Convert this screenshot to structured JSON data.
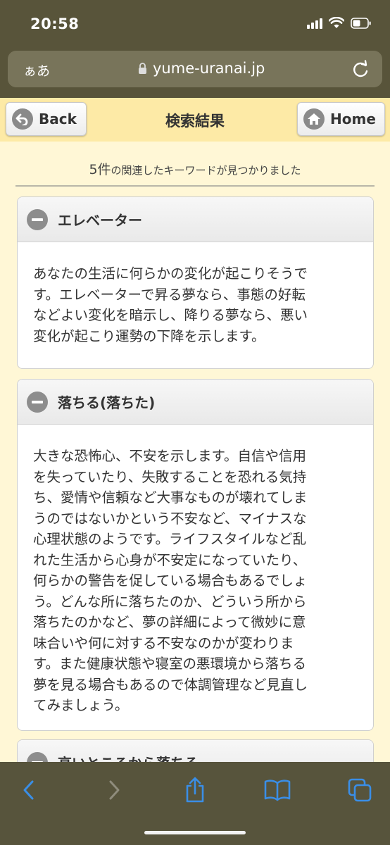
{
  "status_bar": {
    "time": "20:58"
  },
  "url_bar": {
    "aa": "ぁあ",
    "host": "yume-uranai.jp"
  },
  "header": {
    "back_label": "Back",
    "title": "検索結果",
    "home_label": "Home"
  },
  "results": {
    "count": "5件",
    "count_suffix": "の関連したキーワードが見つかりました"
  },
  "cards": [
    {
      "title": "エレベーター",
      "lines": [
        "あなたの生活に何らかの変化が起こりそうで",
        "す。エレベーターで昇る夢なら、事態の好転",
        "などよい変化を暗示し、降りる夢なら、悪い",
        "変化が起こり運勢の下降を示します。"
      ]
    },
    {
      "title": "落ちる(落ちた)",
      "lines": [
        "大きな恐怖心、不安を示します。自信や信用",
        "を失っていたり、失敗することを恐れる気持",
        "ち、愛情や信頼など大事なものが壊れてしま",
        "うのではないかという不安など、マイナスな",
        "心理状態のようです。ライフスタイルなど乱",
        "れた生活から心身が不安定になっていたり、",
        "何らかの警告を促している場合もあるでしょ",
        "う。どんな所に落ちたのか、どういう所から",
        "落ちたのかなど、夢の詳細によって微妙に意",
        "味合いや何に対する不安なのかが変わりま",
        "す。また健康状態や寝室の悪環境から落ちる",
        "夢を見る場合もあるので体調管理など見直し",
        "てみましょう。"
      ]
    },
    {
      "title": "高いところから落ちる",
      "lines": []
    }
  ],
  "colors": {
    "header_bg": "#fdeaa6",
    "page_bg": "#fff7d6",
    "chrome_bg": "#58543a",
    "toolbar_icon": "#3a8ee6"
  },
  "icons": {
    "back": "back-arrow-icon",
    "home": "house-icon",
    "toggle": "minus-icon"
  }
}
